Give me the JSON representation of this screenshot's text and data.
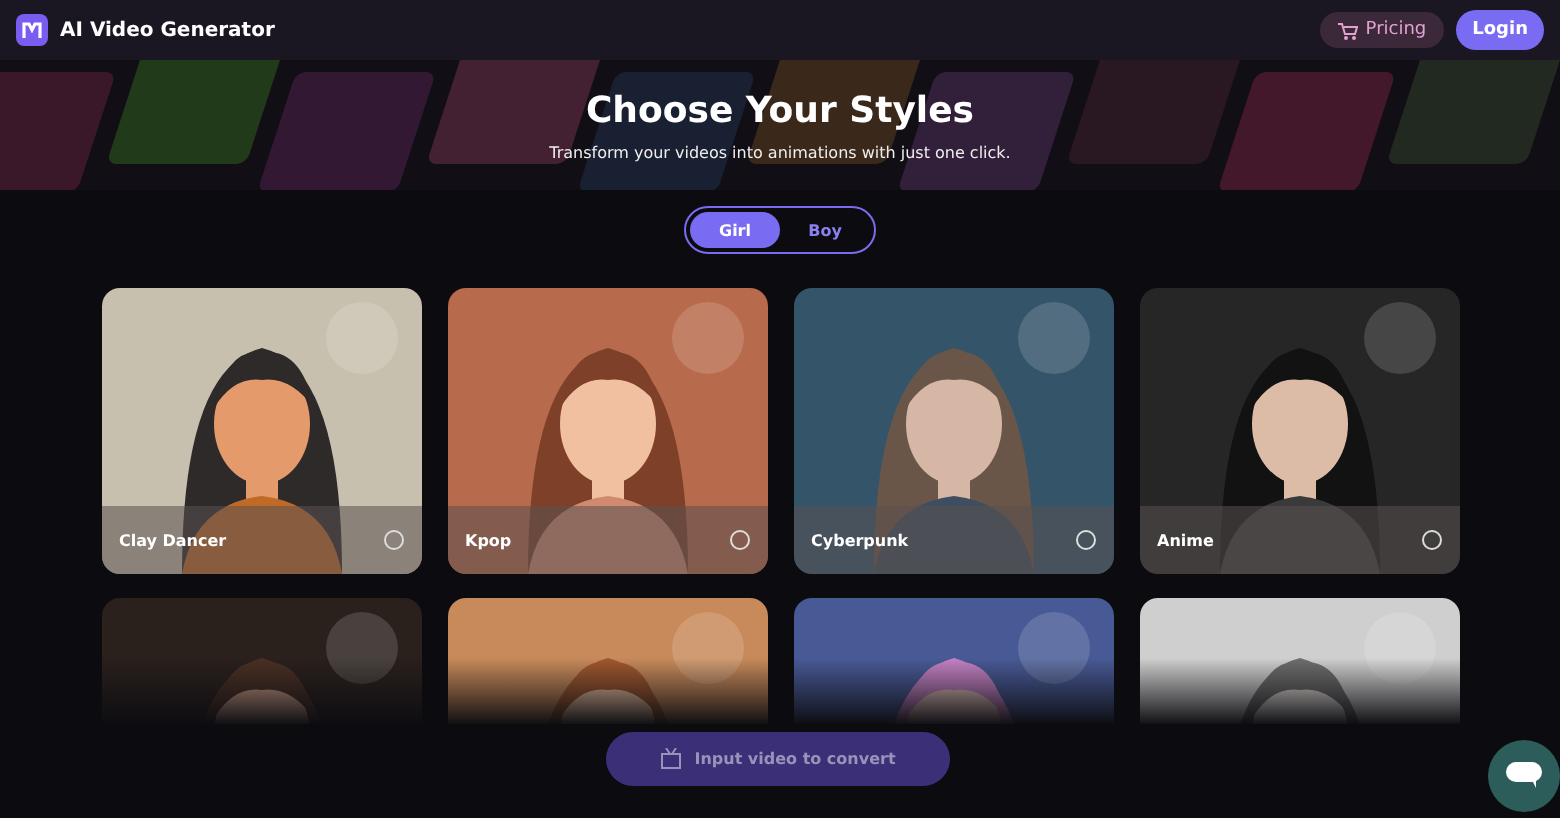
{
  "header": {
    "title": "AI Video Generator",
    "pricing": "Pricing",
    "login": "Login"
  },
  "banner": {
    "title": "Choose Your Styles",
    "subtitle": "Transform your videos into animations with just one click."
  },
  "toggle": [
    {
      "label": "Girl",
      "selected": true
    },
    {
      "label": "Boy",
      "selected": false
    }
  ],
  "styles": [
    {
      "kind": "style",
      "label": "Clay Dancer",
      "selected": false
    },
    {
      "kind": "style",
      "label": "Kpop",
      "selected": false
    },
    {
      "kind": "style",
      "label": "Cyberpunk",
      "selected": false
    },
    {
      "kind": "style",
      "label": "Anime",
      "selected": false
    },
    {
      "kind": "picture"
    },
    {
      "kind": "picture"
    },
    {
      "kind": "picture"
    },
    {
      "kind": "picture"
    }
  ],
  "convert_button": "Input video to convert"
}
